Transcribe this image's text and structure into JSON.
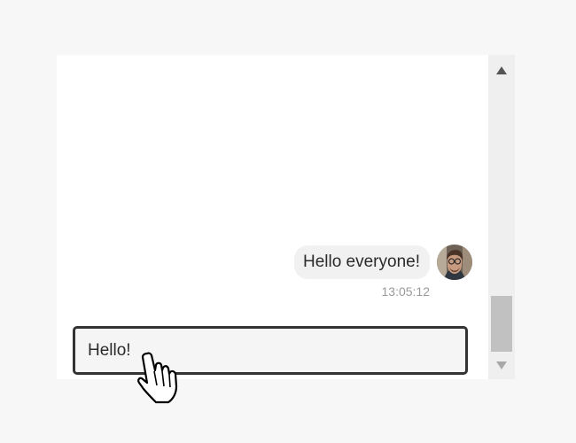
{
  "chat": {
    "messages": [
      {
        "text": "Hello everyone!",
        "timestamp": "13:05:12",
        "avatar_icon": "user-avatar"
      }
    ]
  },
  "composer": {
    "value": "Hello!"
  },
  "scrollbar": {
    "up_icon": "triangle-up-icon",
    "down_icon": "triangle-down-icon",
    "position": 1
  },
  "cursor": {
    "icon": "hand-pointer-icon"
  },
  "colors": {
    "page_background": "#f7f7f7",
    "chat_background": "#ffffff",
    "bubble_background": "#f1f1f1",
    "input_border": "#333333",
    "timestamp_color": "#9a9a9a",
    "scrollbar_track": "#efefef",
    "scrollbar_thumb": "#c1c1c1"
  }
}
